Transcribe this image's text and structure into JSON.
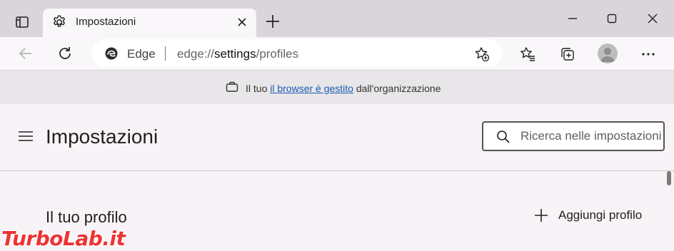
{
  "window": {
    "tab_title": "Impostazioni",
    "new_tab_symbol": "+"
  },
  "toolbar": {
    "brand": "Edge",
    "url_prefix": "edge://",
    "url_host": "settings",
    "url_path": "/profiles"
  },
  "infobar": {
    "prefix": "Il tuo",
    "link": "il browser è gestito",
    "suffix": "dall'organizzazione"
  },
  "settings": {
    "page_title": "Impostazioni",
    "search_placeholder": "Ricerca nelle impostazioni",
    "section_title": "Il tuo profilo",
    "add_profile_label": "Aggiungi profilo"
  },
  "watermark": {
    "text": "TurboLab.it"
  },
  "icons": {
    "tab_actions": "tab-actions-icon",
    "settings_gear": "gear-icon",
    "close": "close-icon",
    "new_tab": "plus-icon",
    "minimize": "minimize-icon",
    "maximize": "maximize-icon",
    "window_close": "close-icon",
    "back": "back-arrow-icon",
    "refresh": "refresh-icon",
    "edge_logo": "edge-logo-icon",
    "add_favorite": "star-plus-icon",
    "favorites": "favorites-icon",
    "collections": "collections-icon",
    "profile": "avatar-icon",
    "more": "more-icon",
    "briefcase": "briefcase-icon",
    "menu": "hamburger-icon",
    "search": "search-icon",
    "add": "plus-icon"
  },
  "colors": {
    "titlebar": "#d9d5db",
    "link": "#1a5bb8",
    "watermark": "#e33333"
  }
}
